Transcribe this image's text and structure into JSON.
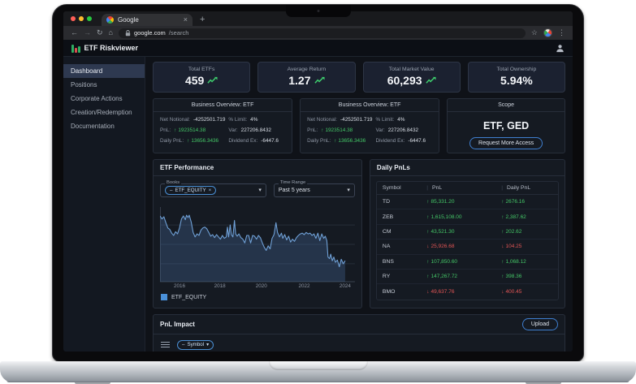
{
  "browser": {
    "tab_title": "Google",
    "close_tab": "×",
    "new_tab": "+",
    "url_domain": "google.com",
    "url_path": "/search"
  },
  "icons": {
    "back": "←",
    "forward": "→",
    "reload": "↻",
    "home": "⌂",
    "star": "☆",
    "kebab": "⋮",
    "caret": "▾",
    "chip_dash": "–",
    "chip_remove": "×",
    "up": "↑",
    "down": "↓"
  },
  "header": {
    "app_title": "ETF Riskviewer"
  },
  "sidebar": {
    "items": [
      {
        "label": "Dashboard",
        "active": true
      },
      {
        "label": "Positions",
        "active": false
      },
      {
        "label": "Corporate Actions",
        "active": false
      },
      {
        "label": "Creation/Redemption",
        "active": false
      },
      {
        "label": "Documentation",
        "active": false
      }
    ]
  },
  "stats": [
    {
      "label": "Total ETFs",
      "value": "459",
      "trend": true
    },
    {
      "label": "Average Return",
      "value": "1.27",
      "trend": true
    },
    {
      "label": "Total Market Value",
      "value": "60,293",
      "trend": true
    },
    {
      "label": "Total Ownership",
      "value": "5.94%",
      "trend": false
    }
  ],
  "business_cards": [
    {
      "title": "Business Overview: ETF",
      "left": [
        {
          "label": "Net Notional:",
          "value": "-4252501.719",
          "dir": null
        },
        {
          "label": "PnL:",
          "value": "1923514.38",
          "dir": "up"
        },
        {
          "label": "Daily PnL:",
          "value": "13656.3436",
          "dir": "up"
        }
      ],
      "right": [
        {
          "label": "% Limit:",
          "value": "4%",
          "dir": null
        },
        {
          "label": "Var:",
          "value": "227206.8432",
          "dir": null
        },
        {
          "label": "Dividend Ex:",
          "value": "-6447.6",
          "dir": null
        }
      ]
    },
    {
      "title": "Business Overview: ETF",
      "left": [
        {
          "label": "Net Notional:",
          "value": "-4252501.719",
          "dir": null
        },
        {
          "label": "PnL:",
          "value": "1923514.38",
          "dir": "up"
        },
        {
          "label": "Daily PnL:",
          "value": "13656.3436",
          "dir": "up"
        }
      ],
      "right": [
        {
          "label": "% Limit:",
          "value": "4%",
          "dir": null
        },
        {
          "label": "Var:",
          "value": "227206.8432",
          "dir": null
        },
        {
          "label": "Dividend Ex:",
          "value": "-6447.6",
          "dir": null
        }
      ]
    }
  ],
  "scope": {
    "title": "Scope",
    "value": "ETF, GED",
    "button_label": "Request More Access"
  },
  "performance": {
    "title": "ETF Performance",
    "books_label": "Books",
    "books_chip": "ETF_EQUITY",
    "time_range_label": "Time Range",
    "time_range_value": "Past 5 years",
    "legend": "ETF_EQUITY"
  },
  "chart_data": {
    "type": "area",
    "title": "ETF Performance",
    "legend_position": "bottom",
    "grid": true,
    "y_ticks_visible": false,
    "ylim": [
      0,
      100
    ],
    "x_ticks": [
      {
        "label": "2016",
        "pos": 10
      },
      {
        "label": "2018",
        "pos": 30.7
      },
      {
        "label": "2020",
        "pos": 52
      },
      {
        "label": "2022",
        "pos": 74
      },
      {
        "label": "2024",
        "pos": 95
      }
    ],
    "series": [
      {
        "name": "ETF_EQUITY",
        "line_color": "#6fa0d6",
        "fill_color": "rgba(73,110,158,0.32)",
        "points": [
          [
            0,
            88
          ],
          [
            1,
            84
          ],
          [
            2,
            87
          ],
          [
            3,
            79
          ],
          [
            4,
            72
          ],
          [
            5,
            70
          ],
          [
            6,
            65
          ],
          [
            7,
            62
          ],
          [
            8,
            67
          ],
          [
            9,
            64
          ],
          [
            10,
            72
          ],
          [
            11,
            84
          ],
          [
            12,
            88
          ],
          [
            13,
            83
          ],
          [
            13.6,
            89
          ],
          [
            14.4,
            86
          ],
          [
            15,
            89
          ],
          [
            16,
            80
          ],
          [
            17,
            66
          ],
          [
            18,
            60
          ],
          [
            19,
            64
          ],
          [
            20,
            62
          ],
          [
            21,
            69
          ],
          [
            22,
            72
          ],
          [
            23,
            73
          ],
          [
            24,
            71
          ],
          [
            25,
            66
          ],
          [
            26,
            61
          ],
          [
            27,
            63
          ],
          [
            28,
            59
          ],
          [
            29,
            63
          ],
          [
            30,
            60
          ],
          [
            31,
            57
          ],
          [
            32,
            62
          ],
          [
            33,
            58
          ],
          [
            34,
            60
          ],
          [
            34.6,
            73
          ],
          [
            35.2,
            60
          ],
          [
            36,
            76
          ],
          [
            36.6,
            63
          ],
          [
            37.4,
            60
          ],
          [
            38.2,
            82
          ],
          [
            38.8,
            64
          ],
          [
            39.6,
            61
          ],
          [
            40.5,
            64
          ],
          [
            41.5,
            59
          ],
          [
            42.5,
            57
          ],
          [
            43.5,
            52
          ],
          [
            44.5,
            62
          ],
          [
            45.5,
            62
          ],
          [
            46.5,
            52
          ],
          [
            47.5,
            62
          ],
          [
            48.5,
            61
          ],
          [
            49.5,
            57
          ],
          [
            50.5,
            62
          ],
          [
            51.5,
            59
          ],
          [
            52.5,
            52
          ],
          [
            53.5,
            46
          ],
          [
            54.5,
            42
          ],
          [
            55.5,
            48
          ],
          [
            56.5,
            44
          ],
          [
            57.5,
            58
          ],
          [
            58.5,
            63
          ],
          [
            59.5,
            79
          ],
          [
            60.3,
            66
          ],
          [
            61.3,
            60
          ],
          [
            62.3,
            65
          ],
          [
            63,
            58
          ],
          [
            64,
            63
          ],
          [
            65,
            56
          ],
          [
            66,
            61
          ],
          [
            67,
            53
          ],
          [
            68,
            57
          ],
          [
            69,
            54
          ],
          [
            70,
            59
          ],
          [
            71,
            62
          ],
          [
            72,
            64
          ],
          [
            73,
            65
          ],
          [
            74,
            63
          ],
          [
            75,
            66
          ],
          [
            76,
            64
          ],
          [
            77,
            65
          ],
          [
            78,
            62
          ],
          [
            79,
            64
          ],
          [
            80,
            58
          ],
          [
            81,
            65
          ],
          [
            82,
            55
          ],
          [
            83,
            64
          ],
          [
            84,
            58
          ],
          [
            84.8,
            61
          ],
          [
            85.6,
            55
          ],
          [
            86.2,
            33
          ],
          [
            87,
            31
          ],
          [
            87.6,
            37
          ],
          [
            88.4,
            28
          ],
          [
            89.2,
            33
          ],
          [
            90,
            26
          ],
          [
            91,
            29
          ],
          [
            92,
            20
          ],
          [
            93,
            30
          ],
          [
            94,
            24
          ],
          [
            95,
            28
          ]
        ]
      }
    ]
  },
  "daily_pnls": {
    "title": "Daily PnLs",
    "columns": [
      "Symbol",
      "PnL",
      "Daily PnL"
    ],
    "rows": [
      {
        "symbol": "TD",
        "pnl": "85,331.20",
        "pnl_dir": "up",
        "daily": "2676.16",
        "daily_dir": "up"
      },
      {
        "symbol": "ZEB",
        "pnl": "1,615,108.00",
        "pnl_dir": "up",
        "daily": "2,387.62",
        "daily_dir": "up"
      },
      {
        "symbol": "CM",
        "pnl": "43,521.30",
        "pnl_dir": "up",
        "daily": "202.62",
        "daily_dir": "up"
      },
      {
        "symbol": "NA",
        "pnl": "25,926.68",
        "pnl_dir": "down",
        "daily": "104.25",
        "daily_dir": "down"
      },
      {
        "symbol": "BNS",
        "pnl": "107,850.60",
        "pnl_dir": "up",
        "daily": "1,068.12",
        "daily_dir": "up"
      },
      {
        "symbol": "RY",
        "pnl": "147,267.72",
        "pnl_dir": "up",
        "daily": "398.36",
        "daily_dir": "up"
      },
      {
        "symbol": "BMO",
        "pnl": "49,637.76",
        "pnl_dir": "down",
        "daily": "400.45",
        "daily_dir": "down"
      }
    ]
  },
  "pnl_impact": {
    "title": "PnL Impact",
    "upload_label": "Upload",
    "filter_chip": "Symbol"
  },
  "colors": {
    "green": "#44c767",
    "red": "#e25555",
    "accent_blue": "#3f7fd0",
    "chart_line": "#6fa0d6",
    "chart_fill": "rgba(73,110,158,0.32)",
    "legend_swatch": "#4a90d9",
    "panel_bg": "#151a22",
    "page_bg": "#0f1218"
  }
}
